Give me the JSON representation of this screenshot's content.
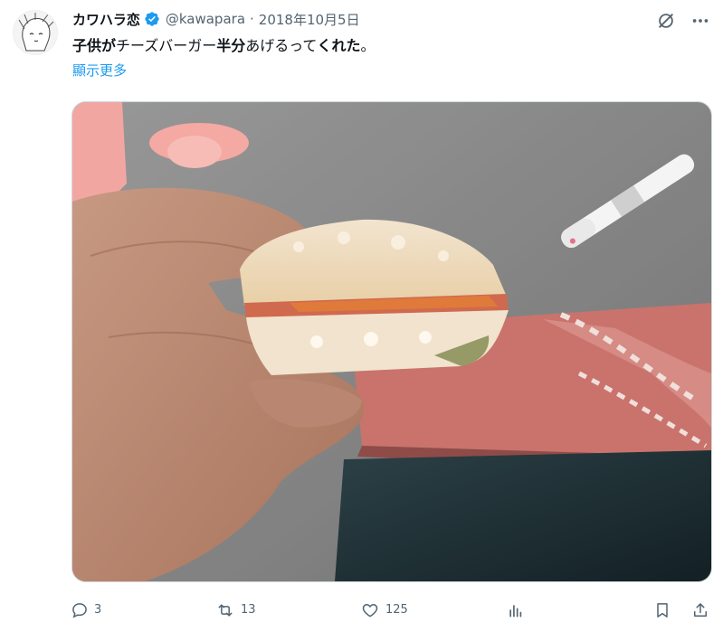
{
  "author": {
    "display_name": "カワハラ恋",
    "handle": "@kawapara",
    "separator": "·",
    "date": "2018年10月5日",
    "verified": true
  },
  "tweet": {
    "text_parts": [
      "子供が",
      "チーズバーガー",
      "半分",
      "あげるって",
      "くれた",
      "。"
    ],
    "show_more": "顯示更多"
  },
  "media": {
    "icon": "photo-hand-holding-cheeseburger-half"
  },
  "metrics": {
    "replies": "3",
    "reposts": "13",
    "likes": "125"
  },
  "icons": {
    "grok": "grok-icon",
    "more": "more-icon",
    "reply": "reply-icon",
    "repost": "repost-icon",
    "like": "heart-icon",
    "views": "views-icon",
    "bookmark": "bookmark-icon",
    "share": "share-icon"
  },
  "colors": {
    "link": "#1d9bf0",
    "verified": "#1d9bf0",
    "muted": "#536471",
    "text": "#0f1419"
  }
}
